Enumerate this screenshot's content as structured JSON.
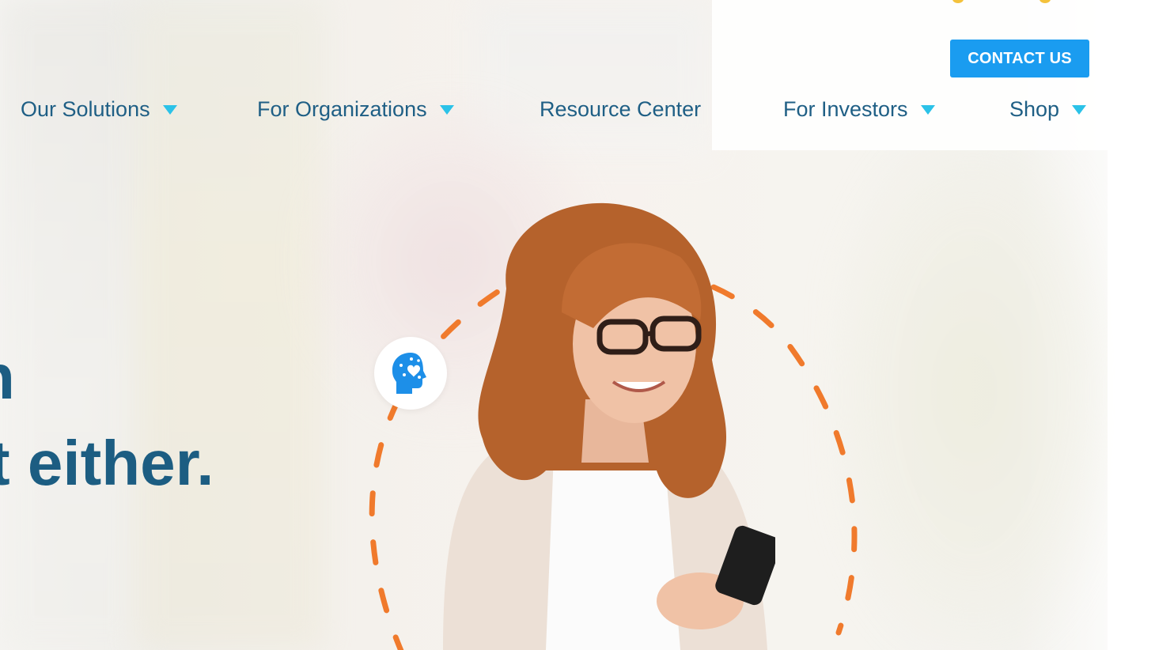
{
  "header": {
    "contact_button": "CONTACT US"
  },
  "nav": {
    "items": [
      {
        "label": "Our Solutions",
        "has_dropdown": true
      },
      {
        "label": "For Organizations",
        "has_dropdown": true
      },
      {
        "label": "Resource Center",
        "has_dropdown": false
      },
      {
        "label": "For Investors",
        "has_dropdown": true
      },
      {
        "label": "Shop",
        "has_dropdown": true
      }
    ]
  },
  "hero": {
    "headline_line1_fragment": "n",
    "headline_line2_fragment": "t either."
  },
  "icons": {
    "badge": "brain-heart-icon",
    "caret": "caret-down-icon"
  },
  "colors": {
    "primary_button": "#1a9cf0",
    "nav_text": "#1f5f85",
    "caret": "#2bc2e8",
    "headline": "#1c5d82",
    "dash_ring": "#f07a2c"
  }
}
